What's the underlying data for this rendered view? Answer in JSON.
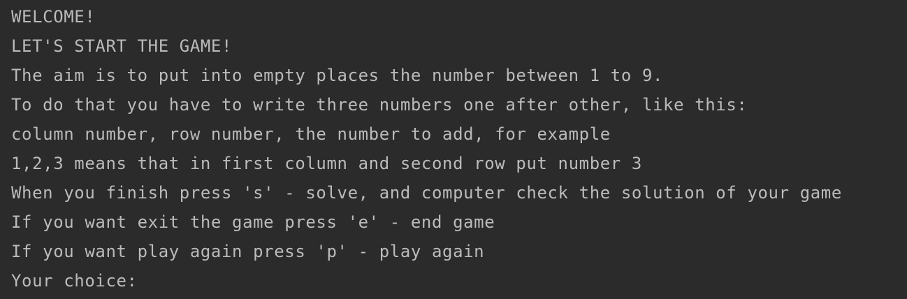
{
  "console": {
    "lines": [
      "WELCOME!",
      "LET'S START THE GAME!",
      "The aim is to put into empty places the number between 1 to 9.",
      "To do that you have to write three numbers one after other, like this:",
      "column number, row number, the number to add, for example",
      "1,2,3 means that in first column and second row put number 3",
      "When you finish press 's' - solve, and computer check the solution of your game",
      "If you want exit the game press 'e' - end game",
      "If you want play again press 'p' - play again"
    ],
    "prompt": "Your choice: "
  },
  "colors": {
    "background": "#2b2b2b",
    "text": "#bbbbbb"
  }
}
